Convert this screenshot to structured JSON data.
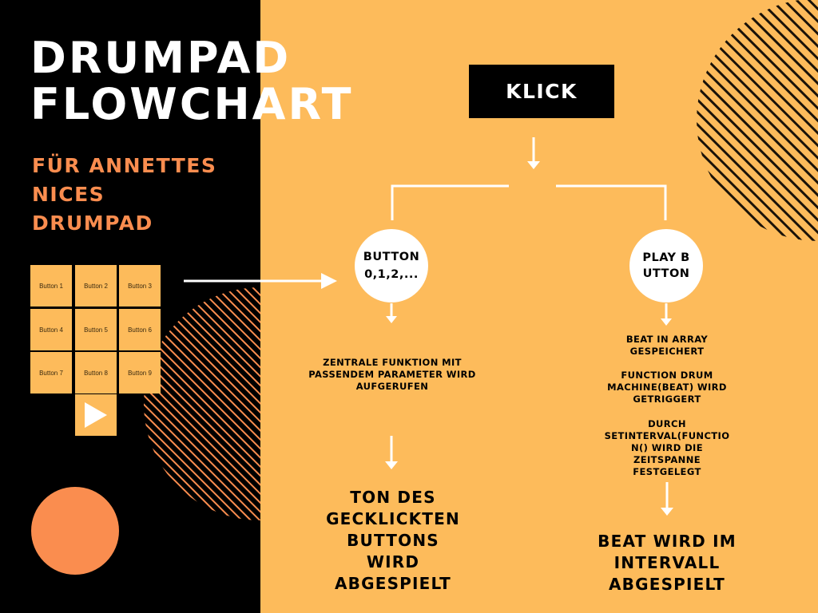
{
  "title": {
    "line1": "DRUMPAD",
    "line2": "FLOWCHART"
  },
  "subtitle": {
    "line1": "FÜR ANNETTES",
    "line2": "NICES",
    "line3": "DRUMPAD"
  },
  "drumpad": {
    "buttons": [
      "Button 1",
      "Button 2",
      "Button 3",
      "Button 4",
      "Button 5",
      "Button 6",
      "Button 7",
      "Button 8",
      "Button 9"
    ],
    "play_icon": "play-icon"
  },
  "flow": {
    "start": "KLICK",
    "left_node": {
      "line1": "BUTTON",
      "line2": "0,1,2,..."
    },
    "right_node": "PLAY BUTTON",
    "left_step": {
      "line1": "ZENTRALE FUNKTION MIT",
      "line2": "PASSENDEM PARAMETER WIRD",
      "line3": "AUFGERUFEN"
    },
    "left_result": {
      "line1": "TON DES",
      "line2": "GECKLICKTEN",
      "line3": "BUTTONS",
      "line4": "WIRD",
      "line5": "ABGESPIELT"
    },
    "right_step1": {
      "line1": "BEAT IN ARRAY",
      "line2": "GESPEICHERT"
    },
    "right_step2": {
      "line1": "FUNCTION DRUM",
      "line2": "MACHINE(BEAT) WIRD",
      "line3": "GETRIGGERT"
    },
    "right_step3": {
      "line1": "DURCH",
      "line2": "SETINTERVAL(FUNCTIO",
      "line3": "N() WIRD DIE",
      "line4": "ZEITSPANNE",
      "line5": "FESTGELEGT"
    },
    "right_result": {
      "line1": "BEAT WIRD IM",
      "line2": "INTERVALL",
      "line3": "ABGESPIELT"
    }
  },
  "colors": {
    "background_left": "#000000",
    "background_right": "#fdbb5b",
    "accent_orange": "#fa8d4f",
    "text_white": "#ffffff"
  }
}
